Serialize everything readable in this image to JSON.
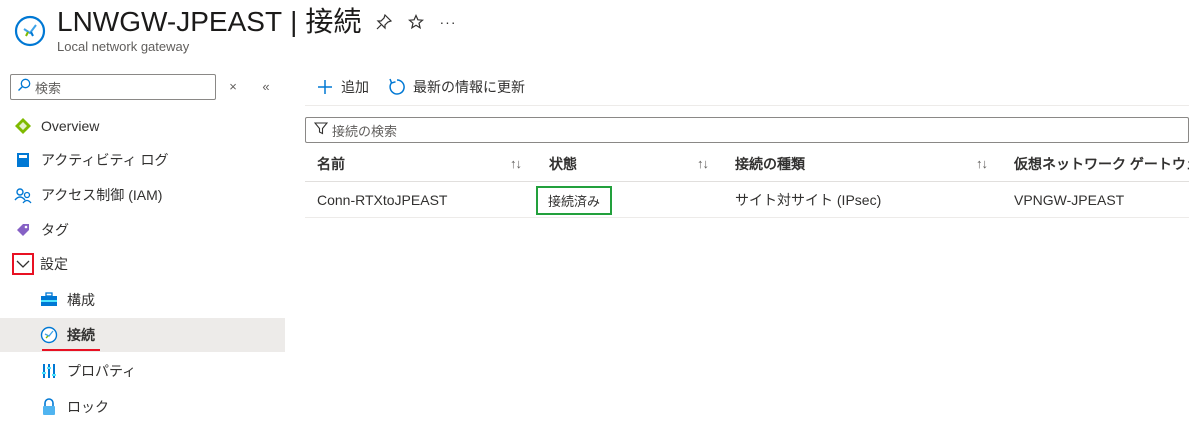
{
  "header": {
    "resource_name": "LNWGW-JPEAST",
    "separator": "|",
    "page_name": "接続",
    "subtitle": "Local network gateway",
    "actions": [
      {
        "icon": "pin-icon",
        "glyph": "✈"
      },
      {
        "icon": "star-icon",
        "glyph": "☆"
      },
      {
        "icon": "more-icon",
        "glyph": "···"
      }
    ]
  },
  "sidebar": {
    "search_placeholder": "検索",
    "clear_glyph": "×",
    "collapse_glyph": "«",
    "items": [
      {
        "label": "Overview",
        "icon": "overview-icon"
      },
      {
        "label": "アクティビティ ログ",
        "icon": "activity-log-icon"
      },
      {
        "label": "アクセス制御 (IAM)",
        "icon": "iam-icon"
      },
      {
        "label": "タグ",
        "icon": "tag-icon"
      },
      {
        "label": "設定",
        "icon": "chevron-down-icon"
      },
      {
        "label": "構成",
        "icon": "configuration-icon"
      },
      {
        "label": "接続",
        "icon": "connection-icon"
      },
      {
        "label": "プロパティ",
        "icon": "properties-icon"
      },
      {
        "label": "ロック",
        "icon": "lock-icon"
      }
    ]
  },
  "toolbar": {
    "add_label": "追加",
    "refresh_label": "最新の情報に更新"
  },
  "filter": {
    "placeholder": "接続の検索"
  },
  "table": {
    "columns": [
      "名前",
      "状態",
      "接続の種類",
      "仮想ネットワーク ゲートウェイ"
    ],
    "sort_glyph": "↑↓",
    "rows": [
      {
        "name": "Conn-RTXtoJPEAST",
        "status": "接続済み",
        "type": "サイト対サイト (IPsec)",
        "gateway": "VPNGW-JPEAST"
      }
    ]
  },
  "colors": {
    "accent": "#0078d4",
    "highlight_red": "#e81123",
    "status_green": "#22a03c"
  }
}
